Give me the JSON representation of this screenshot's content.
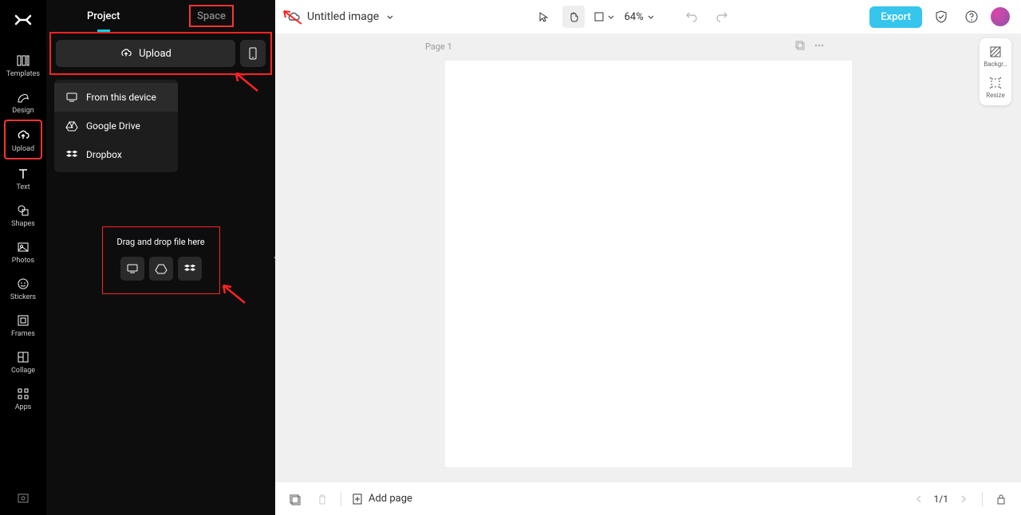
{
  "nav_rail": {
    "items": [
      {
        "label": "Templates",
        "icon": "templates-icon"
      },
      {
        "label": "Design",
        "icon": "design-icon"
      },
      {
        "label": "Upload",
        "icon": "upload-icon",
        "active": true
      },
      {
        "label": "Text",
        "icon": "text-icon"
      },
      {
        "label": "Shapes",
        "icon": "shapes-icon"
      },
      {
        "label": "Photos",
        "icon": "photos-icon"
      },
      {
        "label": "Stickers",
        "icon": "stickers-icon"
      },
      {
        "label": "Frames",
        "icon": "frames-icon"
      },
      {
        "label": "Collage",
        "icon": "collage-icon"
      },
      {
        "label": "Apps",
        "icon": "apps-icon"
      }
    ]
  },
  "side_panel": {
    "tabs": {
      "project": "Project",
      "space": "Space"
    },
    "upload_label": "Upload",
    "menu": {
      "device": "From this device",
      "gdrive": "Google Drive",
      "dropbox": "Dropbox"
    },
    "drop_text": "Drag and drop file here"
  },
  "header": {
    "title": "Untitled image",
    "zoom": "64%",
    "export": "Export"
  },
  "canvas": {
    "page_label": "Page 1"
  },
  "right_tools": {
    "background": "Backgr…",
    "resize": "Resize"
  },
  "footer": {
    "add_page": "Add page",
    "page_counter": "1/1"
  }
}
